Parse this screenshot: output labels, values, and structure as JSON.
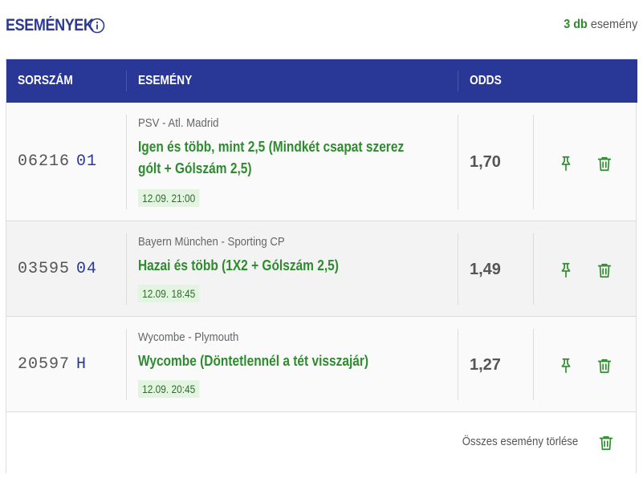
{
  "header": {
    "title": "ESEMÉNYEK",
    "count_num": "3 db",
    "count_label": "esemény"
  },
  "table": {
    "columns": [
      "SORSZÁM",
      "ESEMÉNY",
      "ODDS"
    ]
  },
  "rows": [
    {
      "code": "06216",
      "suffix": "01",
      "match": "PSV - Atl. Madrid",
      "bet_line1": "Igen és több, mint 2,5 (Mindkét csapat szerez",
      "bet_line2": "gólt + Gólszám 2,5)",
      "date": "12.09. 21:00",
      "odds": "1,70"
    },
    {
      "code": "03595",
      "suffix": "04",
      "match": "Bayern München - Sporting CP",
      "bet_line1": "Hazai és több (1X2 + Gólszám 2,5)",
      "bet_line2": "",
      "date": "12.09. 18:45",
      "odds": "1,49"
    },
    {
      "code": "20597",
      "suffix": "H",
      "match": "Wycombe - Plymouth",
      "bet_line1": "Wycombe (Döntetlennél a tét visszajár)",
      "bet_line2": "",
      "date": "12.09. 20:45",
      "odds": "1,27"
    }
  ],
  "footer": {
    "clear_all_label": "Összes esemény törlése"
  },
  "colors": {
    "brand_blue": "#293896",
    "green": "#2e8b2e",
    "date_bg": "#e3f5e0"
  },
  "icons": [
    "info-icon",
    "pin-icon",
    "trash-icon"
  ]
}
